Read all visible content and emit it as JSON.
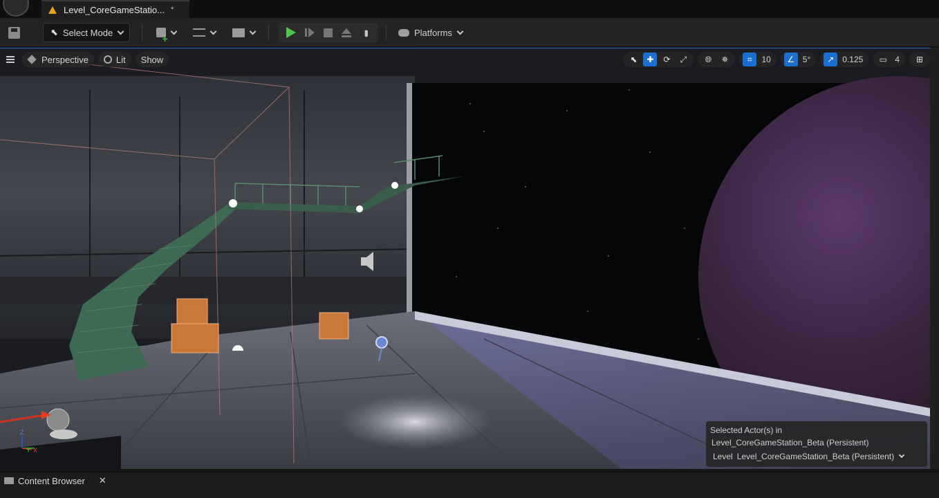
{
  "document_tab": {
    "title": "Level_CoreGameStatio...",
    "dirty_marker": "*"
  },
  "toolbar": {
    "select_mode_label": "Select Mode",
    "platforms_label": "Platforms",
    "icons": [
      "save-icon",
      "add-actor-icon",
      "blueprint-icon",
      "cinematics-icon",
      "play-icon",
      "step-icon",
      "stop-icon",
      "eject-icon",
      "more-icon",
      "gamepad-icon"
    ]
  },
  "viewport": {
    "view_mode": "Perspective",
    "lighting": "Lit",
    "show_label": "Show",
    "grid_snap": "10",
    "rotation_snap": "5°",
    "scale_snap": "0.125",
    "camera_speed": "4",
    "selected_panel": {
      "line1": "Selected Actor(s) in",
      "line2": "Level_CoreGameStation_Beta (Persistent)",
      "level_label": "Level",
      "level_value": "Level_CoreGameStation_Beta (Persistent)"
    },
    "axis_labels": {
      "z": "Z",
      "y": "Y",
      "x": "X"
    }
  },
  "bottom": {
    "content_browser_label": "Content Browser"
  },
  "colors": {
    "accent": "#1a6fd1",
    "play": "#4cc84c",
    "warning": "#e8a018"
  }
}
